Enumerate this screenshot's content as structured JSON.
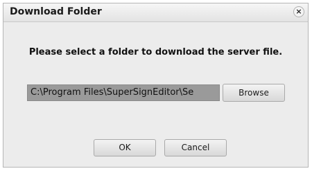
{
  "dialog": {
    "title": "Download Folder",
    "close_label": "×",
    "message": "Please select a folder to download the server file.",
    "path_value": "C:\\Program Files\\SuperSignEditor\\Se",
    "browse_label": "Browse",
    "ok_label": "OK",
    "cancel_label": "Cancel"
  },
  "colors": {
    "dialog_background": "#ececec",
    "path_field_background": "#9a9a9a"
  }
}
